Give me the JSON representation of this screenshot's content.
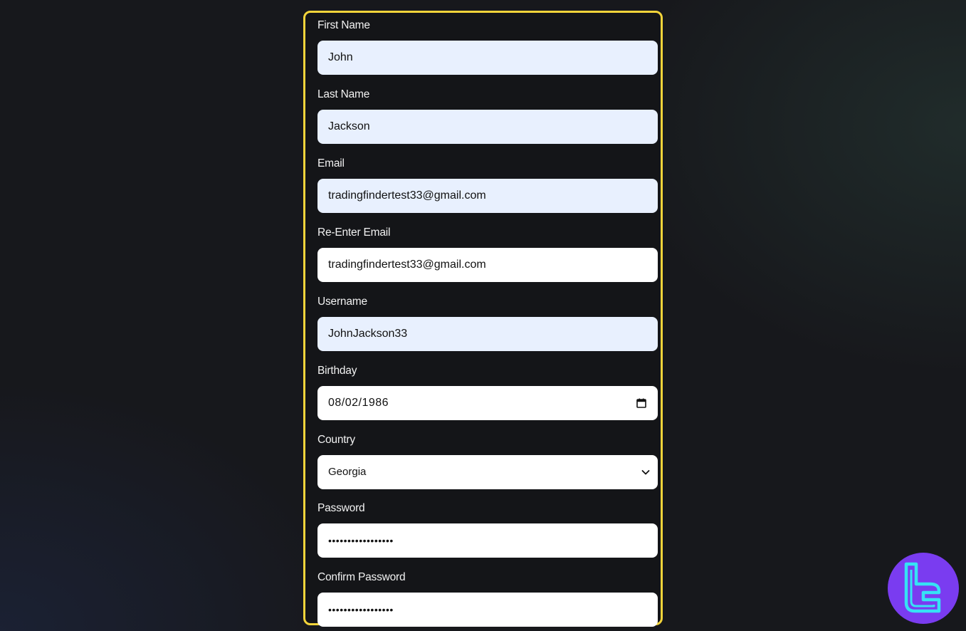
{
  "form": {
    "fields": [
      {
        "label": "First Name",
        "value": "John"
      },
      {
        "label": "Last Name",
        "value": "Jackson"
      },
      {
        "label": "Email",
        "value": "tradingfindertest33@gmail.com"
      },
      {
        "label": "Re-Enter Email",
        "value": "tradingfindertest33@gmail.com"
      },
      {
        "label": "Username",
        "value": "JohnJackson33"
      },
      {
        "label": "Birthday",
        "value": "08/02/1986"
      },
      {
        "label": "Country",
        "value": "Georgia"
      },
      {
        "label": "Password",
        "value": "•••••••••••••••••"
      },
      {
        "label": "Confirm Password",
        "value": "•••••••••••••••••"
      }
    ]
  },
  "colors": {
    "highlight_border": "#f3d43a",
    "autofill_background": "#e8f0fe",
    "logo_background": "#7a3cf0",
    "logo_glyph": "#36e2f5"
  },
  "icons": {
    "birthday": "calendar-icon",
    "country": "chevron-down-icon",
    "logo": "logo-icon"
  }
}
